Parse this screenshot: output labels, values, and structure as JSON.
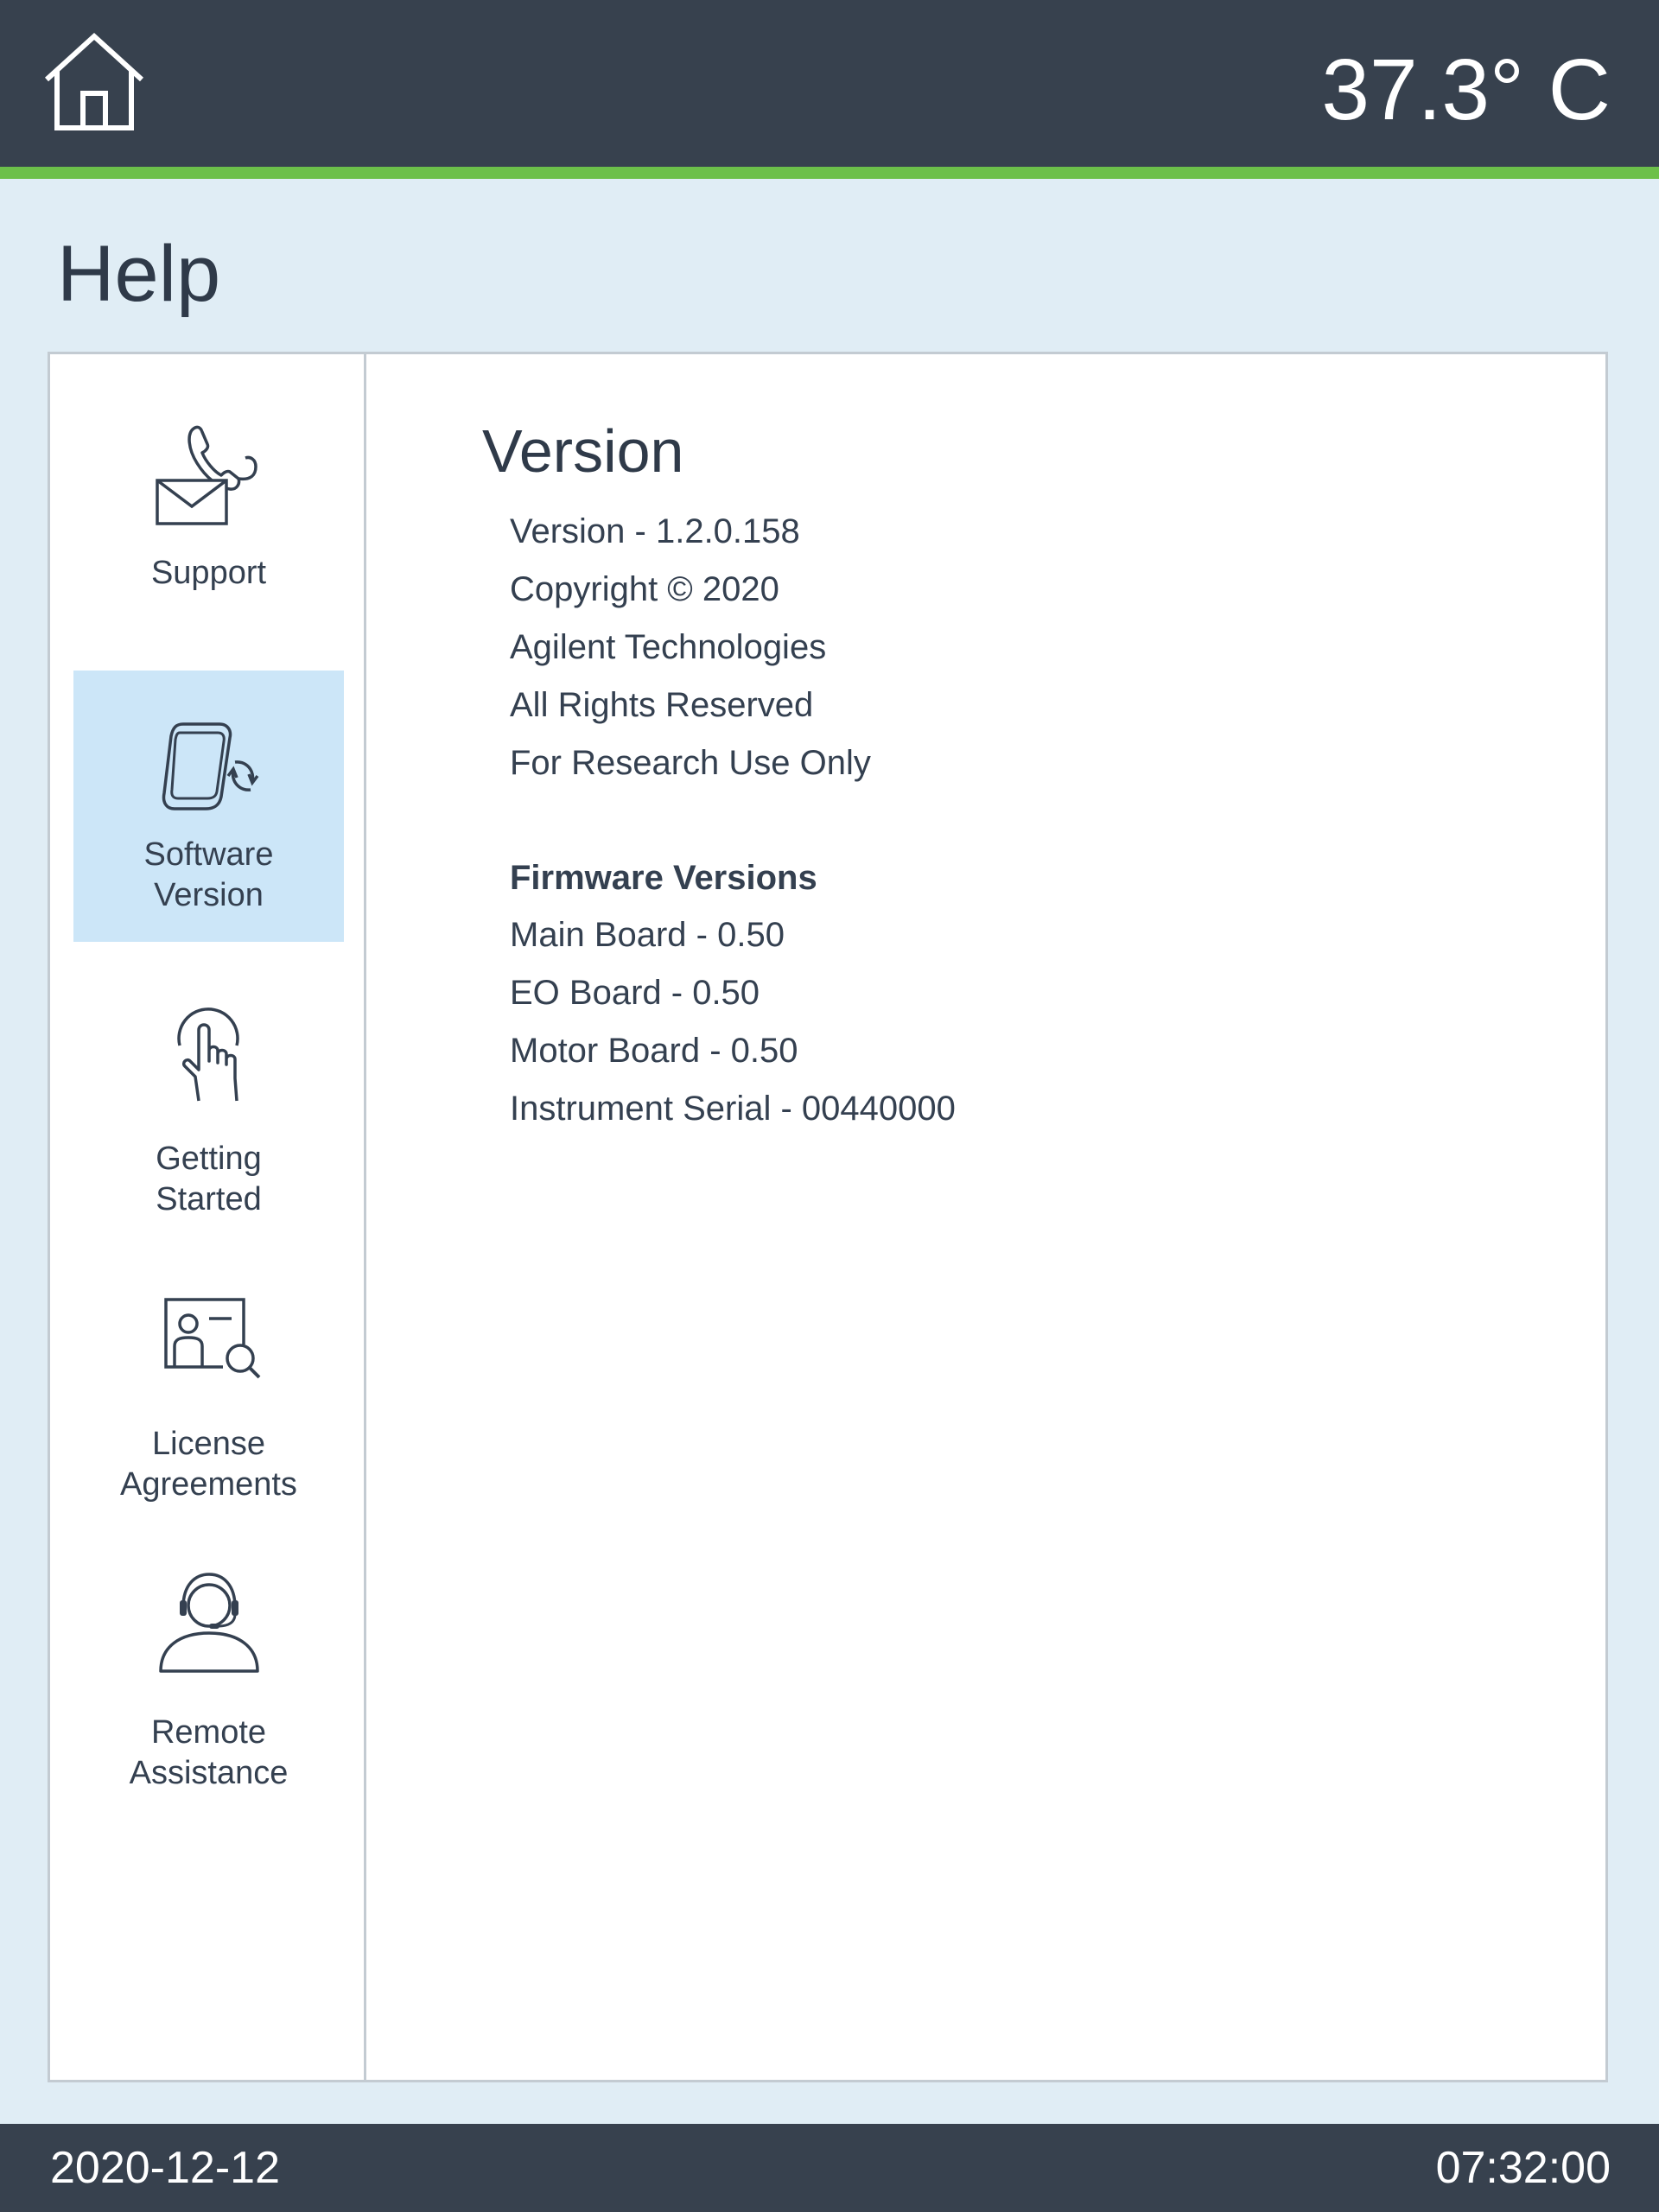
{
  "header": {
    "home_icon": "home-icon",
    "temperature": "37.3° C"
  },
  "page": {
    "title": "Help"
  },
  "sidebar": {
    "items": [
      {
        "label_lines": [
          "Support"
        ],
        "icon": "phone-envelope-icon",
        "selected": false
      },
      {
        "label_lines": [
          "Software",
          "Version"
        ],
        "icon": "device-refresh-icon",
        "selected": true
      },
      {
        "label_lines": [
          "Getting",
          "Started"
        ],
        "icon": "touch-hand-icon",
        "selected": false
      },
      {
        "label_lines": [
          "License",
          "Agreements"
        ],
        "icon": "license-search-icon",
        "selected": false
      },
      {
        "label_lines": [
          "Remote",
          "Assistance"
        ],
        "icon": "headset-agent-icon",
        "selected": false
      }
    ]
  },
  "content": {
    "title": "Version",
    "lines": [
      "Version - 1.2.0.158",
      "Copyright © 2020",
      "Agilent Technologies",
      "All Rights Reserved",
      "For Research Use Only"
    ],
    "firmware_heading": "Firmware Versions",
    "firmware_lines": [
      "Main Board - 0.50",
      "EO Board - 0.50",
      "Motor Board - 0.50",
      "Instrument Serial - 00440000"
    ]
  },
  "footer": {
    "date": "2020-12-12",
    "time": "07:32:00"
  },
  "colors": {
    "header_bg": "#37414e",
    "accent_green": "#6cc04a",
    "page_bg": "#e0edf5",
    "selected_bg": "#cce6f8",
    "text": "#344050"
  }
}
